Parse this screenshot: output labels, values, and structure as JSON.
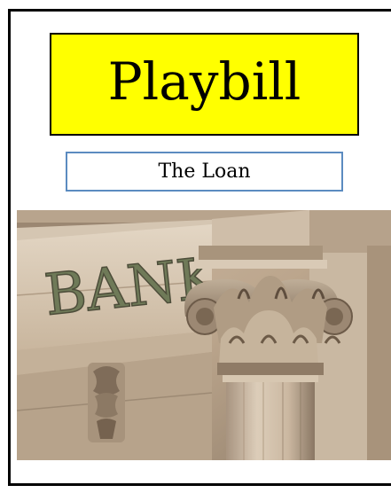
{
  "playbill": {
    "title": "Playbill",
    "subtitle": "The Loan",
    "photo": {
      "engraved_text": "BANK"
    }
  },
  "colors": {
    "title_background": "#ffff00",
    "subtitle_border": "#5b8bc0",
    "frame": "#000000"
  }
}
